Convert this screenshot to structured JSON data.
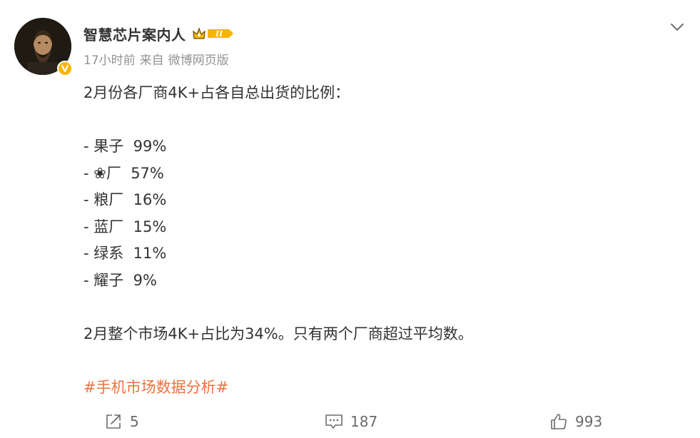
{
  "author": {
    "name": "智慧芯片案内人",
    "vip_level": "II",
    "timestamp": "17小时前",
    "source_prefix": "来自",
    "source": "微博网页版"
  },
  "post": {
    "intro": "2月份各厂商4K+占各自总出货的比例：",
    "items": [
      "- 果子  99%",
      "- ❀厂  57%",
      "- 粮厂  16%",
      "- 蓝厂  15%",
      "- 绿系  11%",
      "- 耀子  9%"
    ],
    "summary": "2月整个市场4K+占比为34%。只有两个厂商超过平均数。",
    "hashtag": "#手机市场数据分析#"
  },
  "actions": {
    "repost_count": "5",
    "comment_count": "187",
    "like_count": "993"
  },
  "icons": {
    "menu": "chevron-down-icon",
    "repost": "repost-icon",
    "comment": "comment-icon",
    "like": "thumbs-up-icon",
    "verified": "verified-v-icon",
    "vip": "crown-vip-icon"
  },
  "colors": {
    "hashtag": "#eb7340",
    "meta": "#939393",
    "verified": "#f7b500",
    "text": "#333333"
  }
}
